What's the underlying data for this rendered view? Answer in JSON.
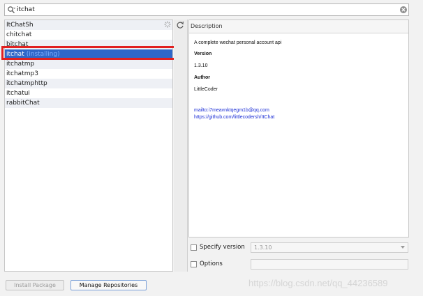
{
  "search": {
    "value": "itchat"
  },
  "packages": [
    {
      "name": "ItChatSh",
      "status": ""
    },
    {
      "name": "chitchat",
      "status": ""
    },
    {
      "name": "bitchat",
      "status": ""
    },
    {
      "name": "itchat",
      "status": "(installing)"
    },
    {
      "name": "itchatmp",
      "status": ""
    },
    {
      "name": "itchatmp3",
      "status": ""
    },
    {
      "name": "itchatmphttp",
      "status": ""
    },
    {
      "name": "itchatui",
      "status": ""
    },
    {
      "name": "rabbitChat",
      "status": ""
    }
  ],
  "selected_index": 3,
  "description": {
    "header": "Description",
    "summary": "A complete wechat personal account api",
    "version_label": "Version",
    "version_value": "1.3.10",
    "author_label": "Author",
    "author_value": "LittleCoder",
    "email_link": "mailto:i7meavnktqegm1b@qq.com",
    "url_link": "https://github.com/littlecodersh/ItChat"
  },
  "options": {
    "specify_version_label": "Specify version",
    "version_value": "1.3.10",
    "options_label": "Options"
  },
  "buttons": {
    "install_label": "Install Package",
    "manage_label": "Manage Repositories"
  },
  "watermark": "https://blog.csdn.net/qq_44236589",
  "colors": {
    "selection": "#2f67c8",
    "highlight_border": "#e02020",
    "link": "#1c2fd6"
  }
}
